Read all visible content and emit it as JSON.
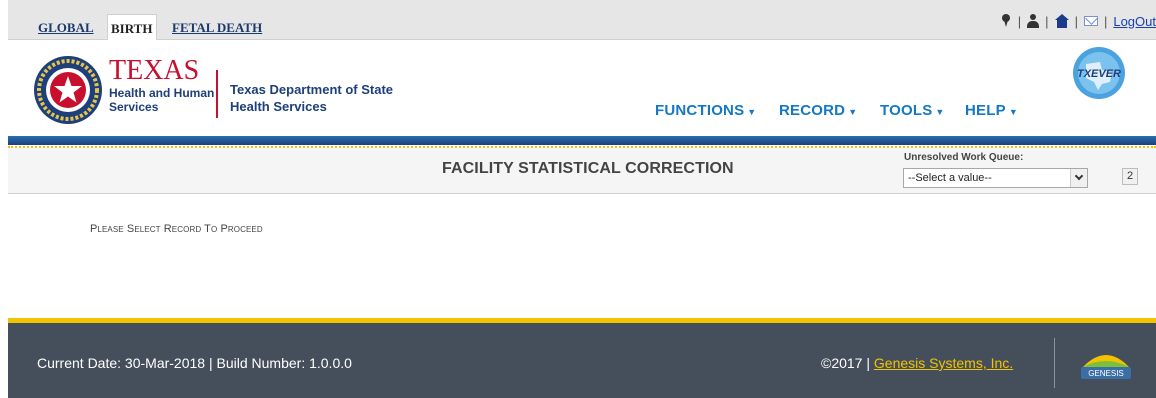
{
  "tabs": [
    {
      "label": "GLOBAL"
    },
    {
      "label": "BIRTH",
      "active": true
    },
    {
      "label": "FETAL DEATH"
    }
  ],
  "topbar": {
    "separator": "|",
    "logout_label": "LogOut",
    "icons": [
      "location-pin-icon",
      "user-icon",
      "home-icon",
      "mail-icon"
    ]
  },
  "brand": {
    "hhs_title": "TEXAS",
    "hhs_line1": "Health and Human",
    "hhs_line2": "Services",
    "dept_line1": "Texas Department of State",
    "dept_line2": "Health Services",
    "txever_text": "TXEVER",
    "colors": {
      "red": "#c8102e",
      "navy": "#1d3f7a",
      "menu_blue": "#1478c4",
      "gold": "#f2c300",
      "footer_bg": "#454f5b"
    }
  },
  "menu": {
    "functions": "FUNCTIONS",
    "record": "RECORD",
    "tools": "TOOLS",
    "help": "HELP"
  },
  "titlebar": {
    "title": "FACILITY STATISTICAL CORRECTION",
    "work_queue_label": "Unresolved Work Queue:",
    "work_queue_value": "--Select a value--",
    "work_queue_count": "2"
  },
  "main": {
    "prompt": "Please Select Record To Proceed"
  },
  "footer": {
    "current_date_label": "Current Date: 30-Mar-2018",
    "separator": "|",
    "build_label": "Build Number: 1.0.0.0",
    "copyright": "©2017",
    "company_link": "Genesis Systems, Inc.",
    "genesis_logo_text": "GENESIS"
  }
}
